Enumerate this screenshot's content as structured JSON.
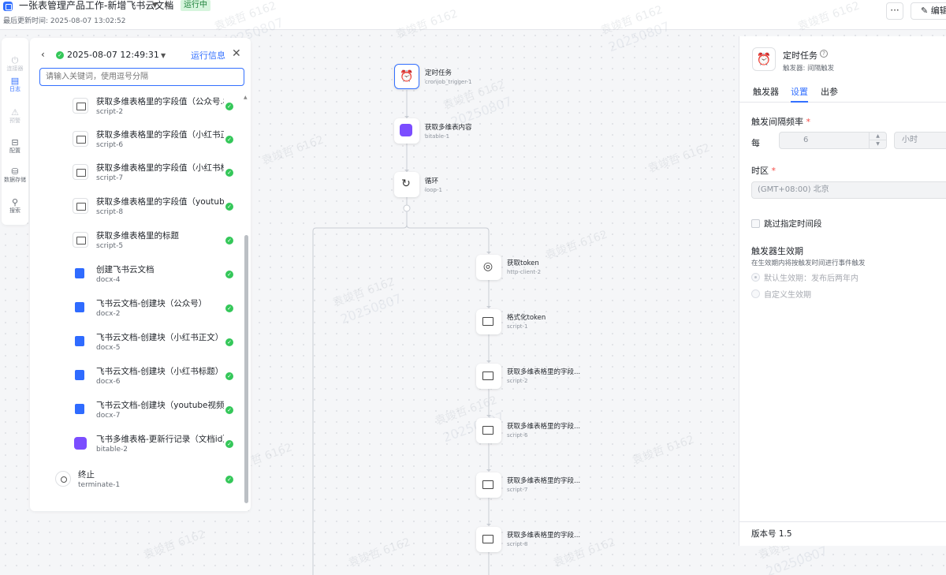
{
  "header": {
    "title": "一张表管理产品工作-新增飞书云文档",
    "status": "运行中",
    "last_updated_label": "最后更新时间:",
    "last_updated_value": "2025-08-07 13:02:52",
    "more_label": "···",
    "edit_label": "编辑"
  },
  "rail": {
    "items": [
      {
        "label": "连接器",
        "icon": "plug-icon"
      },
      {
        "label": "日志",
        "icon": "log-icon"
      },
      {
        "label": "预警",
        "icon": "warning-icon"
      },
      {
        "label": "配置",
        "icon": "config-icon"
      },
      {
        "label": "数据存储",
        "icon": "database-icon"
      },
      {
        "label": "搜索",
        "icon": "search-icon"
      }
    ]
  },
  "log_panel": {
    "run_time": "2025-08-07 12:49:31",
    "info_link": "运行信息",
    "search_placeholder": "请输入关键词，使用逗号分隔",
    "items": [
      {
        "name": "获取多维表格里的字段值（公众号.标",
        "id": "script-2",
        "type": "script"
      },
      {
        "name": "获取多维表格里的字段值（小红书正",
        "id": "script-6",
        "type": "script"
      },
      {
        "name": "获取多维表格里的字段值（小红书标",
        "id": "script-7",
        "type": "script"
      },
      {
        "name": "获取多维表格里的字段值（youtube视",
        "id": "script-8",
        "type": "script"
      },
      {
        "name": "获取多维表格里的标题",
        "id": "script-5",
        "type": "script"
      },
      {
        "name": "创建飞书云文档",
        "id": "docx-4",
        "type": "docx"
      },
      {
        "name": "飞书云文档-创建块（公众号）",
        "id": "docx-2",
        "type": "docx"
      },
      {
        "name": "飞书云文档-创建块（小红书正文）",
        "id": "docx-5",
        "type": "docx"
      },
      {
        "name": "飞书云文档-创建块（小红书标题）",
        "id": "docx-6",
        "type": "docx"
      },
      {
        "name": "飞书云文档-创建块（youtube视频脚",
        "id": "docx-7",
        "type": "docx"
      },
      {
        "name": "飞书多维表格-更新行记录（文档id）",
        "id": "bitable-2",
        "type": "bitable"
      },
      {
        "name": "终止",
        "id": "terminate-1",
        "type": "term"
      }
    ]
  },
  "flow": {
    "nodes": [
      {
        "title": "定时任务",
        "id": "cronjob_trigger-1",
        "icon": "alarm-clock-icon"
      },
      {
        "title": "获取多维表内容",
        "id": "bitable-1",
        "icon": "bitable-icon"
      },
      {
        "title": "循环",
        "id": "loop-1",
        "icon": "loop-icon"
      },
      {
        "title": "获取token",
        "id": "http-client-2",
        "icon": "http-icon"
      },
      {
        "title": "格式化token",
        "id": "script-1",
        "icon": "script-icon"
      },
      {
        "title": "获取多维表格里的字段...",
        "id": "script-2",
        "icon": "script-icon"
      },
      {
        "title": "获取多维表格里的字段...",
        "id": "script-6",
        "icon": "script-icon"
      },
      {
        "title": "获取多维表格里的字段...",
        "id": "script-7",
        "icon": "script-icon"
      },
      {
        "title": "获取多维表格里的字段...",
        "id": "script-8",
        "icon": "script-icon"
      }
    ]
  },
  "settings": {
    "title": "定时任务",
    "subtitle": "触发器: 间隔触发",
    "tabs": [
      "触发器",
      "设置",
      "出参"
    ],
    "active_tab": "设置",
    "interval_label": "触发间隔频率",
    "every_label": "每",
    "interval_value": "6",
    "interval_unit": "小时",
    "timezone_label": "时区",
    "timezone_value": "(GMT+08:00) 北京",
    "skip_label": "跳过指定时间段",
    "validity_label": "触发器生效期",
    "validity_desc": "在生效期内将按触发时间进行事件触发",
    "radio_default": "默认生效期：发布后两年内",
    "radio_custom": "自定义生效期",
    "version_label": "版本号",
    "version_value": "1.5"
  },
  "watermark": {
    "name": "袁竣哲 6162",
    "date": "20250807"
  },
  "colors": {
    "accent": "#3370ff",
    "success": "#34c759",
    "running_tag_bg": "#d6f5dd",
    "bitable_purple": "#7b4dff"
  }
}
